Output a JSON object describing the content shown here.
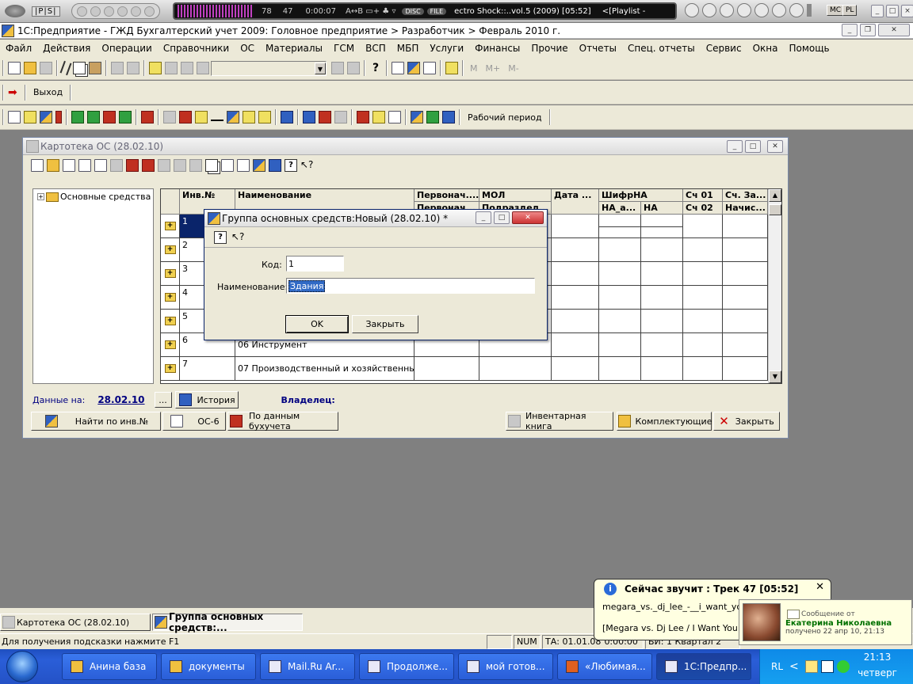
{
  "media_bar": {
    "counter_a": "78",
    "counter_b": "47",
    "time": "0:00:07",
    "modes": "A↔B ▭+ ♣ ▿",
    "disc": "DISC",
    "file": "FILE",
    "track": "ectro Shock::..vol.5 (2009) [05:52]",
    "playlist": "<[Playlist -",
    "mc": "MC",
    "pl": "PL"
  },
  "app": {
    "title": "1С:Предприятие - ГЖД Бухгалтерский учет 2009: Головное предприятие > Разработчик > Февраль 2010 г.",
    "menu": [
      "Файл",
      "Действия",
      "Операции",
      "Справочники",
      "ОС",
      "Материалы",
      "ГСМ",
      "ВСП",
      "МБП",
      "Услуги",
      "Финансы",
      "Прочие",
      "Отчеты",
      "Спец. отчеты",
      "Сервис",
      "Окна",
      "Помощь"
    ],
    "calc_buttons": [
      "M",
      "M+",
      "M-"
    ],
    "exit_label": "Выход",
    "work_period_label": "Рабочий период"
  },
  "kartoteka": {
    "title": "Картотека ОС (28.02.10)",
    "tree_root": "Основные средства",
    "columns": [
      {
        "h1": "Инв.№",
        "h2": ""
      },
      {
        "h1": "Наименование",
        "h2": ""
      },
      {
        "h1": "Первонач....",
        "h2": "Первонач..."
      },
      {
        "h1": "МОЛ",
        "h2": "Подраздел..."
      },
      {
        "h1": "Дата ...",
        "h2": ""
      },
      {
        "h1": "ШифрНА",
        "h2": "НА_а..."
      },
      {
        "h1": "",
        "h2": "НА"
      },
      {
        "h1": "Сч 01",
        "h2": "Сч 02"
      },
      {
        "h1": "Сч. За...",
        "h2": "Начис..."
      }
    ],
    "rows": [
      {
        "inv": "1",
        "name": ""
      },
      {
        "inv": "2",
        "name": ""
      },
      {
        "inv": "3",
        "name": ""
      },
      {
        "inv": "4",
        "name": ""
      },
      {
        "inv": "5",
        "name": ""
      },
      {
        "inv": "6",
        "name": "06 Инструмент"
      },
      {
        "inv": "7",
        "name": "07 Производственный и хозяйственный ин"
      }
    ],
    "data_on_label": "Данные на:",
    "data_on_date": "28.02.10",
    "ellipsis": "...",
    "history_btn": "История",
    "owner_label": "Владелец:",
    "find_btn": "Найти по инв.№",
    "os6_btn": "ОС-6",
    "by_accounting_btn": "По данным бухучета",
    "inventory_book_btn": "Инвентарная книга",
    "components_btn": "Комплектующие",
    "close_btn": "Закрыть"
  },
  "dialog": {
    "title": "Группа основных средств:Новый (28.02.10) *",
    "code_label": "Код:",
    "code_value": "1",
    "name_label": "Наименование:",
    "name_value": "Здания",
    "ok": "OK",
    "close": "Закрыть"
  },
  "window_tabs": [
    "Картотека ОС (28.02.10)",
    "Группа основных средств:..."
  ],
  "status": {
    "hint": "Для получения подсказки нажмите F1",
    "num": "NUM",
    "ta": "ТА: 01.01.08",
    "ta_extra": "0:00:00",
    "bi": "БИ: 1 Квартал 2"
  },
  "now_playing": {
    "title": "Сейчас звучит : Трек 47 [05:52]",
    "line1": "megara_vs._dj_lee_-__i_want_you",
    "line2": "[Megara vs. Dj Lee / I Want You"
  },
  "message": {
    "from_label": "Сообщение от",
    "sender": "Екатерина Николаевна",
    "received": "получено  22 апр 10, 21:13"
  },
  "taskbar": {
    "items": [
      "Анина база",
      "документы",
      "Mail.Ru Ar...",
      "Продолже...",
      "мой готов...",
      "«Любимая...",
      "1С:Предпр..."
    ],
    "lang": "RL",
    "time": "21:13",
    "day": "четверг"
  },
  "colors": {
    "accent": "#0a246a",
    "taskbar": "#2452c6",
    "link": "#000080"
  }
}
